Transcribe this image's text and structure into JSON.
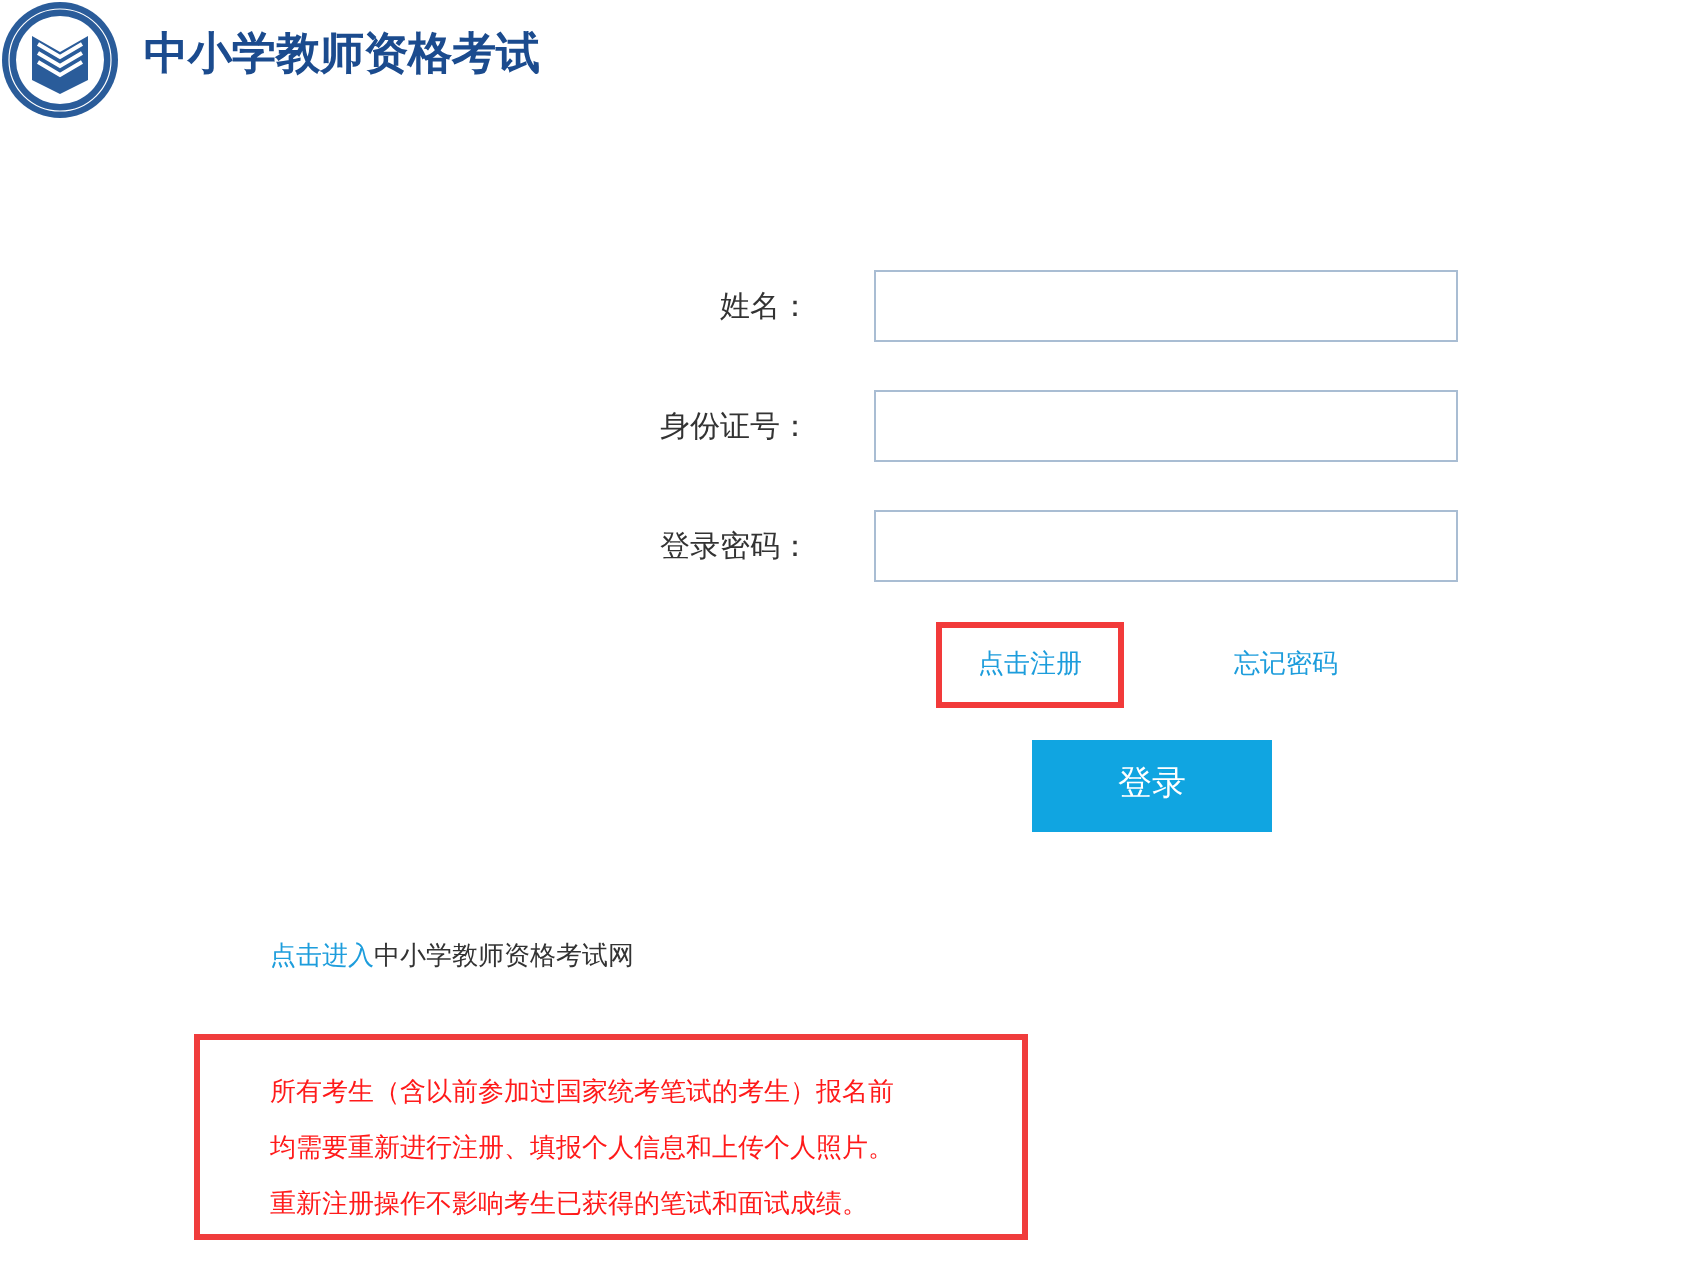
{
  "header": {
    "title": "中小学教师资格考试"
  },
  "form": {
    "fields": [
      {
        "label": "姓名："
      },
      {
        "label": "身份证号："
      },
      {
        "label": "登录密码："
      }
    ],
    "links": [
      {
        "text": "点击注册",
        "highlighted": true
      },
      {
        "text": "忘记密码",
        "highlighted": false
      }
    ],
    "submit": "登录"
  },
  "site_link": {
    "link": "点击进入",
    "text": "中小学教师资格考试网"
  },
  "notice": {
    "lines": [
      "所有考生（含以前参加过国家统考笔试的考生）报名前",
      "均需要重新进行注册、填报个人信息和上传个人照片。",
      "重新注册操作不影响考生已获得的笔试和面试成绩。"
    ]
  }
}
